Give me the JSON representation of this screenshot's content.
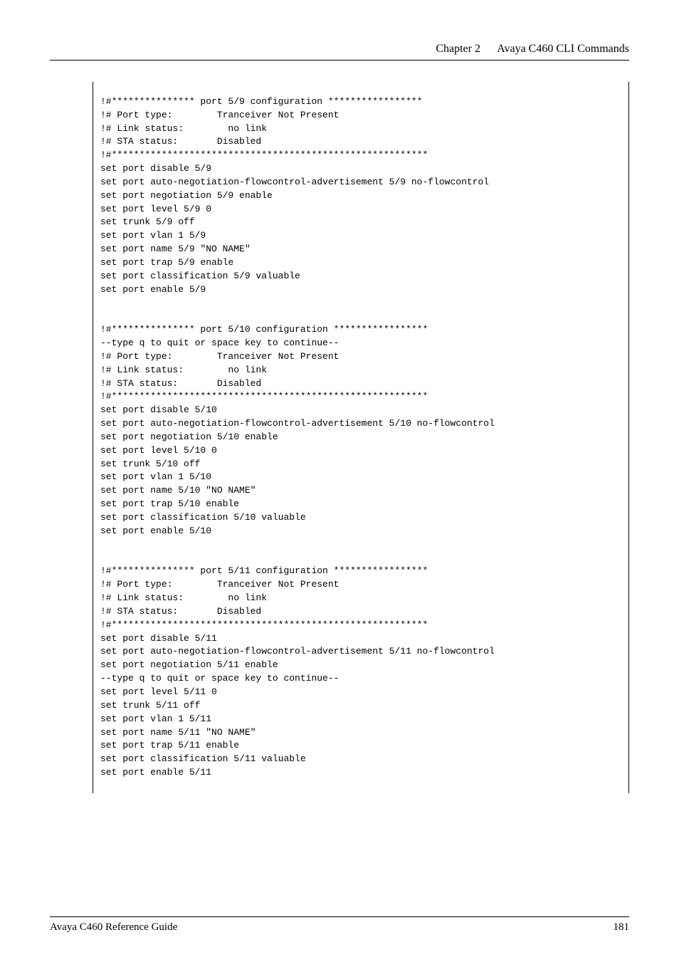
{
  "header": {
    "chapter": "Chapter 2",
    "title": "Avaya C460 CLI Commands"
  },
  "code": "\n!#*************** port 5/9 configuration *****************\n!# Port type:        Tranceiver Not Present\n!# Link status:        no link\n!# STA status:       Disabled\n!#*********************************************************\nset port disable 5/9\nset port auto-negotiation-flowcontrol-advertisement 5/9 no-flowcontrol\nset port negotiation 5/9 enable\nset port level 5/9 0\nset trunk 5/9 off\nset port vlan 1 5/9\nset port name 5/9 \"NO NAME\"\nset port trap 5/9 enable\nset port classification 5/9 valuable\nset port enable 5/9\n\n\n!#*************** port 5/10 configuration *****************\n--type q to quit or space key to continue-- \n!# Port type:        Tranceiver Not Present\n!# Link status:        no link\n!# STA status:       Disabled\n!#*********************************************************\nset port disable 5/10\nset port auto-negotiation-flowcontrol-advertisement 5/10 no-flowcontrol\nset port negotiation 5/10 enable\nset port level 5/10 0\nset trunk 5/10 off\nset port vlan 1 5/10\nset port name 5/10 \"NO NAME\"\nset port trap 5/10 enable\nset port classification 5/10 valuable\nset port enable 5/10\n\n\n!#*************** port 5/11 configuration *****************\n!# Port type:        Tranceiver Not Present\n!# Link status:        no link\n!# STA status:       Disabled\n!#*********************************************************\nset port disable 5/11\nset port auto-negotiation-flowcontrol-advertisement 5/11 no-flowcontrol\nset port negotiation 5/11 enable\n--type q to quit or space key to continue-- \nset port level 5/11 0\nset trunk 5/11 off\nset port vlan 1 5/11\nset port name 5/11 \"NO NAME\"\nset port trap 5/11 enable\nset port classification 5/11 valuable\nset port enable 5/11\n\n",
  "footer": {
    "left": "Avaya C460 Reference Guide",
    "right": "181"
  }
}
